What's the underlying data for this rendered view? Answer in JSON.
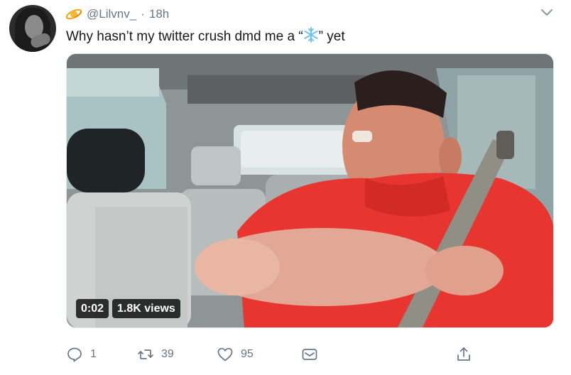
{
  "tweet": {
    "handle": "@Lilvnv_",
    "separator": "·",
    "time": "18h",
    "name_emoji": "saturn-ring-icon",
    "text_before": "Why hasn’t my twitter crush dmd me a “",
    "text_emoji": "snowflake-icon",
    "text_after": "” yet"
  },
  "media": {
    "duration": "0:02",
    "views": "1.8K views"
  },
  "actions": {
    "reply_count": "1",
    "retweet_count": "39",
    "like_count": "95"
  },
  "colors": {
    "text": "#14171a",
    "muted": "#657786",
    "snowflake": "#6fc3ef",
    "shirt": "#e8352f"
  }
}
